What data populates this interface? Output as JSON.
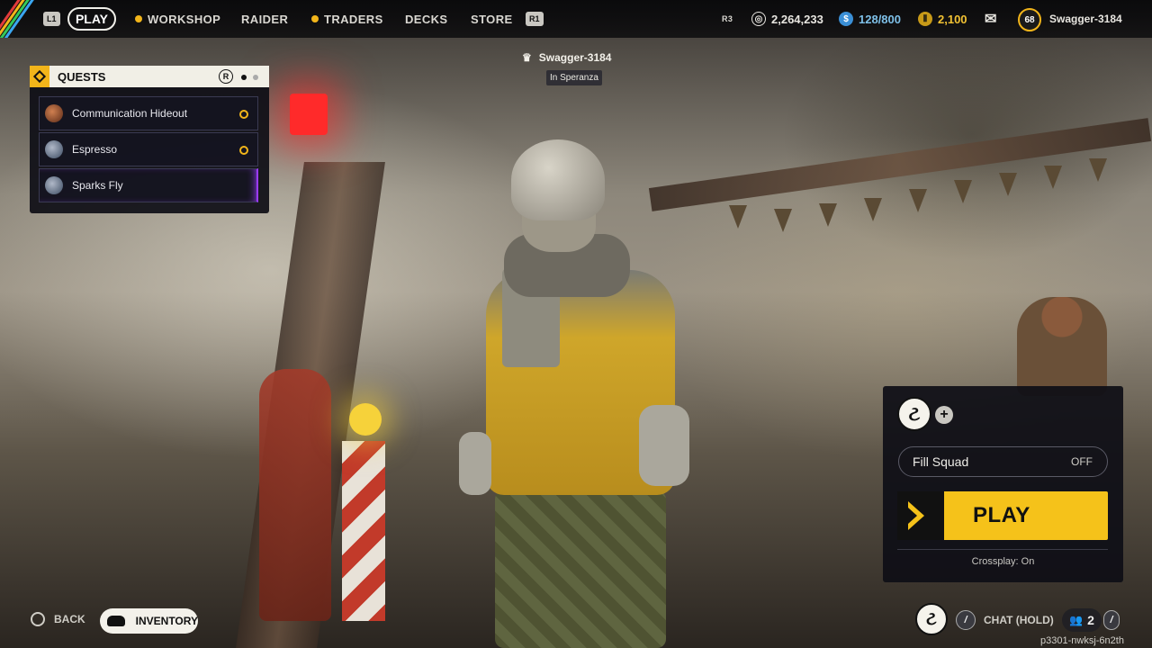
{
  "nav": {
    "l1": "L1",
    "play": "PLAY",
    "workshop": "WORKSHOP",
    "raider": "RAIDER",
    "traders": "TRADERS",
    "decks": "DECKS",
    "store": "STORE",
    "r1": "R1"
  },
  "header": {
    "r3": "R3",
    "currency_coins": "2,264,233",
    "stash": "128/800",
    "raider_tokens": "2,100",
    "level": "68",
    "username": "Swagger-3184"
  },
  "quests": {
    "title": "QUESTS",
    "r_button": "R",
    "items": [
      {
        "label": "Communication Hideout",
        "tracked": true
      },
      {
        "label": "Espresso",
        "tracked": true
      },
      {
        "label": "Sparks Fly",
        "tracked": false
      }
    ]
  },
  "player_tag": {
    "name": "Swagger-3184",
    "location": "In Speranza"
  },
  "squad": {
    "fill_squad_label": "Fill Squad",
    "fill_squad_value": "OFF",
    "play_label": "PLAY",
    "crossplay": "Crossplay: On"
  },
  "bottom": {
    "back": "BACK",
    "inventory": "INVENTORY",
    "chat": "CHAT (HOLD)",
    "party_count": "2",
    "build_id": "p3301-nwksj-6n2th"
  },
  "colors": {
    "accent": "#f5c21a",
    "selected_quest": "#9b3cff",
    "panel": "#0e0e16"
  }
}
